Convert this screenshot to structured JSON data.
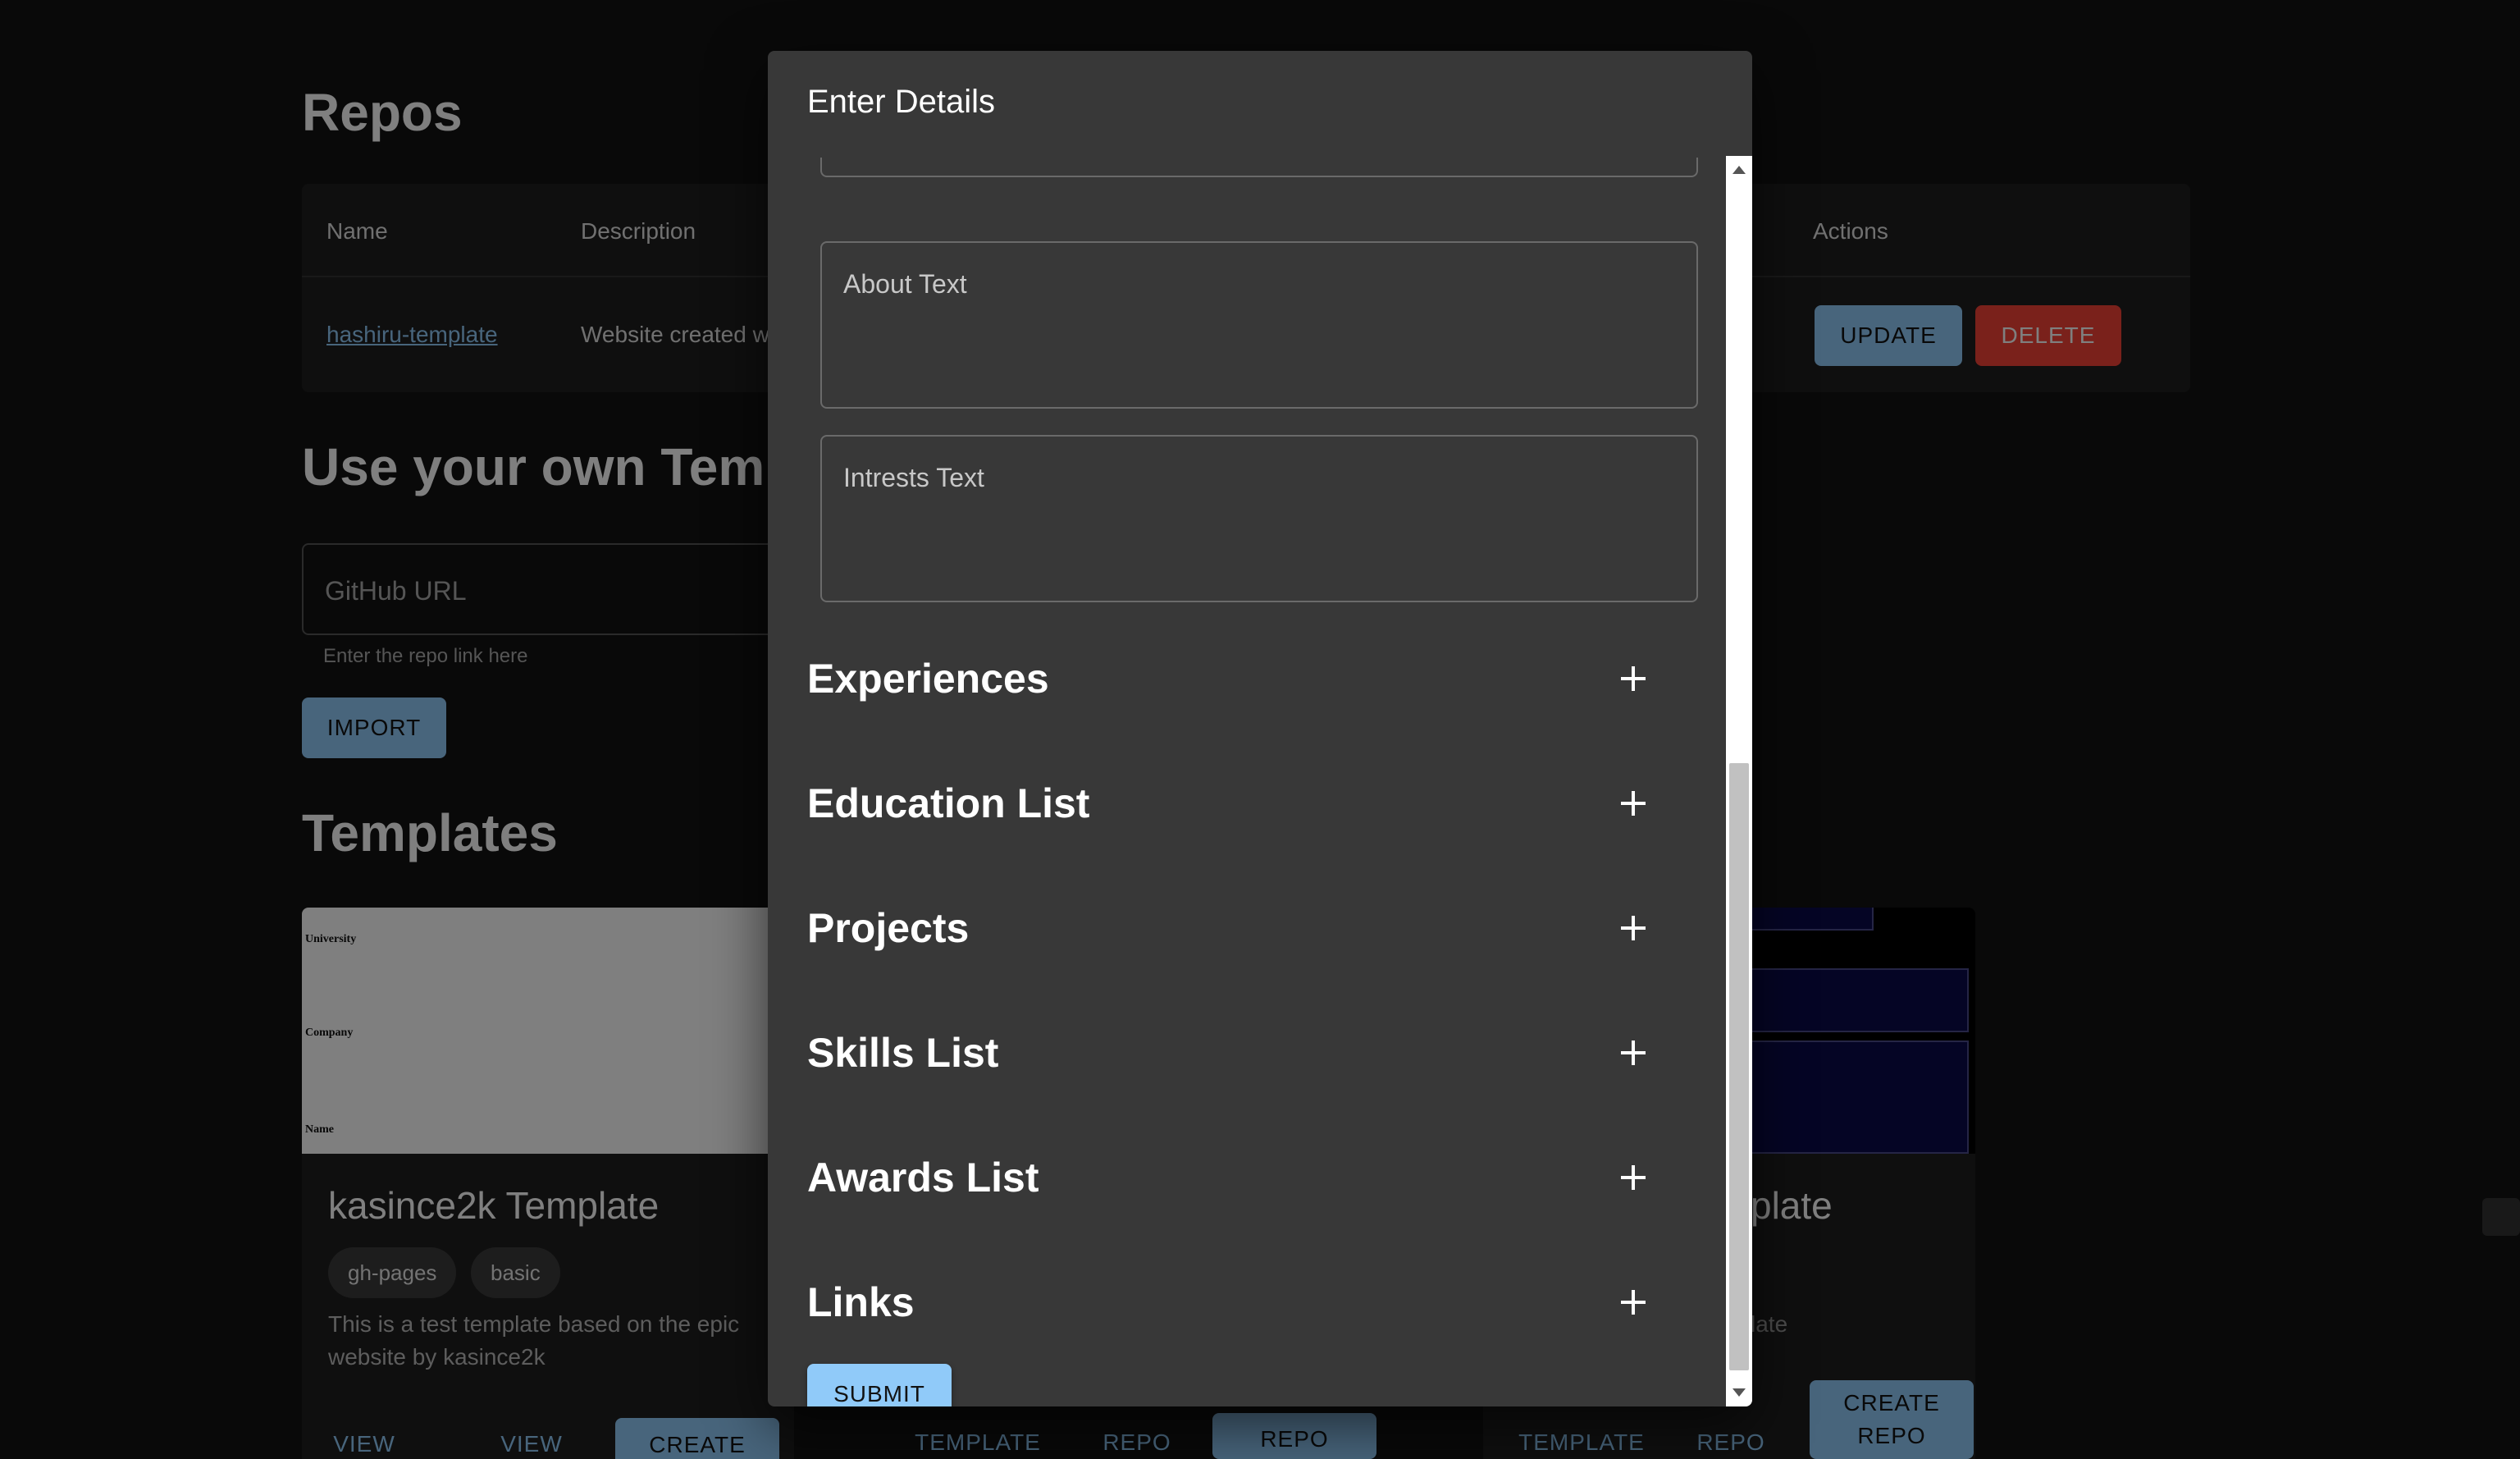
{
  "repos": {
    "title": "Repos",
    "columns": {
      "name": "Name",
      "description": "Description",
      "actions": "Actions"
    },
    "row": {
      "name": "hashiru-template",
      "description": "Website created w",
      "update_label": "UPDATE",
      "delete_label": "DELETE"
    }
  },
  "own_template": {
    "title": "Use your own Tem",
    "url_placeholder": "GitHub URL",
    "helper": "Enter the repo link here",
    "import_label": "IMPORT"
  },
  "templates": {
    "title": "Templates",
    "card1": {
      "title": "kasince2k Template",
      "tags": [
        "gh-pages",
        "basic"
      ],
      "description": "This is a test template based on the epic website by kasince2k",
      "actions": {
        "view": "VIEW",
        "view2": "VIEW",
        "create": "CREATE"
      },
      "preview": {
        "university": "University",
        "company": "Company",
        "name": "Name"
      }
    },
    "card2": {
      "actions": {
        "view_template": "TEMPLATE",
        "view_repo": "REPO",
        "create_repo": "REPO"
      }
    },
    "card3": {
      "title_partial": "plate",
      "desc_partial": "late",
      "actions": {
        "view_template": "TEMPLATE",
        "view_repo": "REPO",
        "create_repo_line1": "CREATE",
        "create_repo_line2": "REPO"
      }
    }
  },
  "dialog": {
    "title": "Enter Details",
    "fields": {
      "about": "About Text",
      "interests": "Intrests Text"
    },
    "sections": [
      "Experiences",
      "Education List",
      "Projects",
      "Skills List",
      "Awards List",
      "Links"
    ],
    "submit_label": "SUBMIT"
  },
  "colors": {
    "accent": "#90caf9",
    "danger": "#f44336",
    "dialog_bg": "#383838",
    "page_bg": "#121212"
  }
}
